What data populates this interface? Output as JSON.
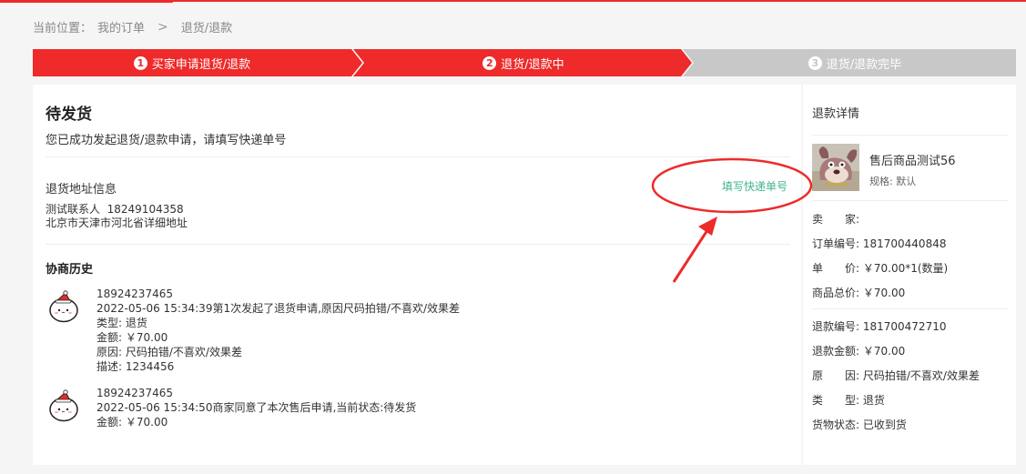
{
  "breadcrumb": {
    "prefix": "当前位置：",
    "parent": "我的订单",
    "separator": ">",
    "current": "退货/退款"
  },
  "steps": [
    {
      "num": "1",
      "label": "买家申请退货/退款",
      "state": "done"
    },
    {
      "num": "2",
      "label": "退货/退款中",
      "state": "active"
    },
    {
      "num": "3",
      "label": "退货/退款完毕",
      "state": "pending"
    }
  ],
  "status": {
    "title": "待发货",
    "message": "您已成功发起退货/退款申请，请填写快递单号"
  },
  "return_address": {
    "heading": "退货地址信息",
    "contact": "测试联系人  18249104358",
    "address": "北京市天津市河北省详细地址",
    "fill_tracking_link": "填写快递单号"
  },
  "history": {
    "heading": "协商历史",
    "entries": [
      {
        "user": "18924237465",
        "event": "2022-05-06 15:34:39第1次发起了退货申请,原因尺码拍错/不喜欢/效果差",
        "type": "类型: 退货",
        "amount": "金额: ￥70.00",
        "reason": "原因: 尺码拍错/不喜欢/效果差",
        "desc": "描述: 1234456"
      },
      {
        "user": "18924237465",
        "event": "2022-05-06 15:34:50商家同意了本次售后申请,当前状态:待发货",
        "amount": "金额: ￥70.00"
      }
    ]
  },
  "refund_detail": {
    "heading": "退款详情",
    "product_name": "售后商品测试56",
    "spec": "规格: 默认",
    "seller": "卖　　家:",
    "order_no": "订单编号: 181700440848",
    "unit_price": "单　　价: ￥70.00*1(数量)",
    "total": "商品总价: ￥70.00",
    "refund_no": "退款编号: 181700472710",
    "refund_amount": "退款金额: ￥70.00",
    "reason": "原　　因: 尺码拍错/不喜欢/效果差",
    "type": "类　　型: 退货",
    "goods_status": "货物状态: 已收到货"
  },
  "colors": {
    "accent_red": "#ee2a2a",
    "link_green": "#3fb48d",
    "step_pending": "#c8c8c8"
  }
}
